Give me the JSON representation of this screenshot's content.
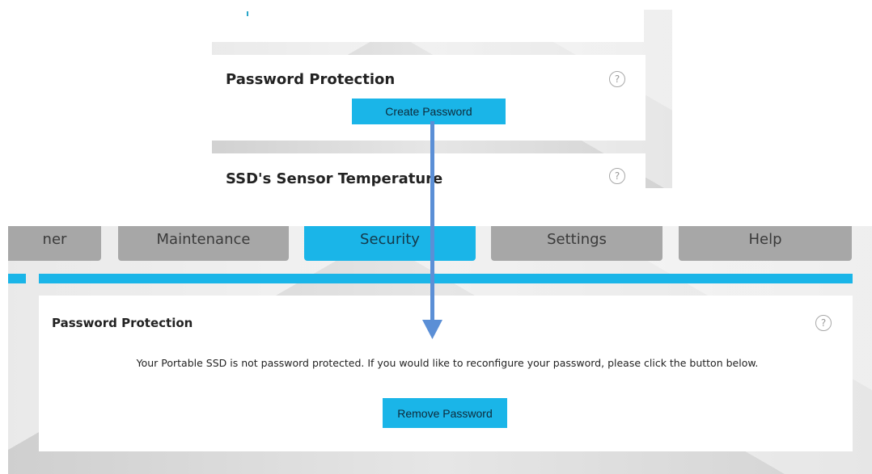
{
  "top_panel": {
    "section_title": "Password Protection",
    "button_label": "Create Password",
    "next_section_title": "SSD's Sensor Temperature",
    "help_symbol": "?"
  },
  "tabs": [
    {
      "label": "ner"
    },
    {
      "label": "Maintenance"
    },
    {
      "label": "Security"
    },
    {
      "label": "Settings"
    },
    {
      "label": "Help"
    }
  ],
  "bottom_panel": {
    "section_title": "Password Protection",
    "message": "Your Portable SSD is not password protected. If you would like to reconfigure your password, please click the button below.",
    "button_label": "Remove Password",
    "help_symbol": "?"
  },
  "colors": {
    "accent": "#1ab5e8",
    "arrow": "#5b8fd6",
    "tab_inactive": "#a7a7a7"
  },
  "icons": [
    "help-icon",
    "arrow-down-icon"
  ]
}
